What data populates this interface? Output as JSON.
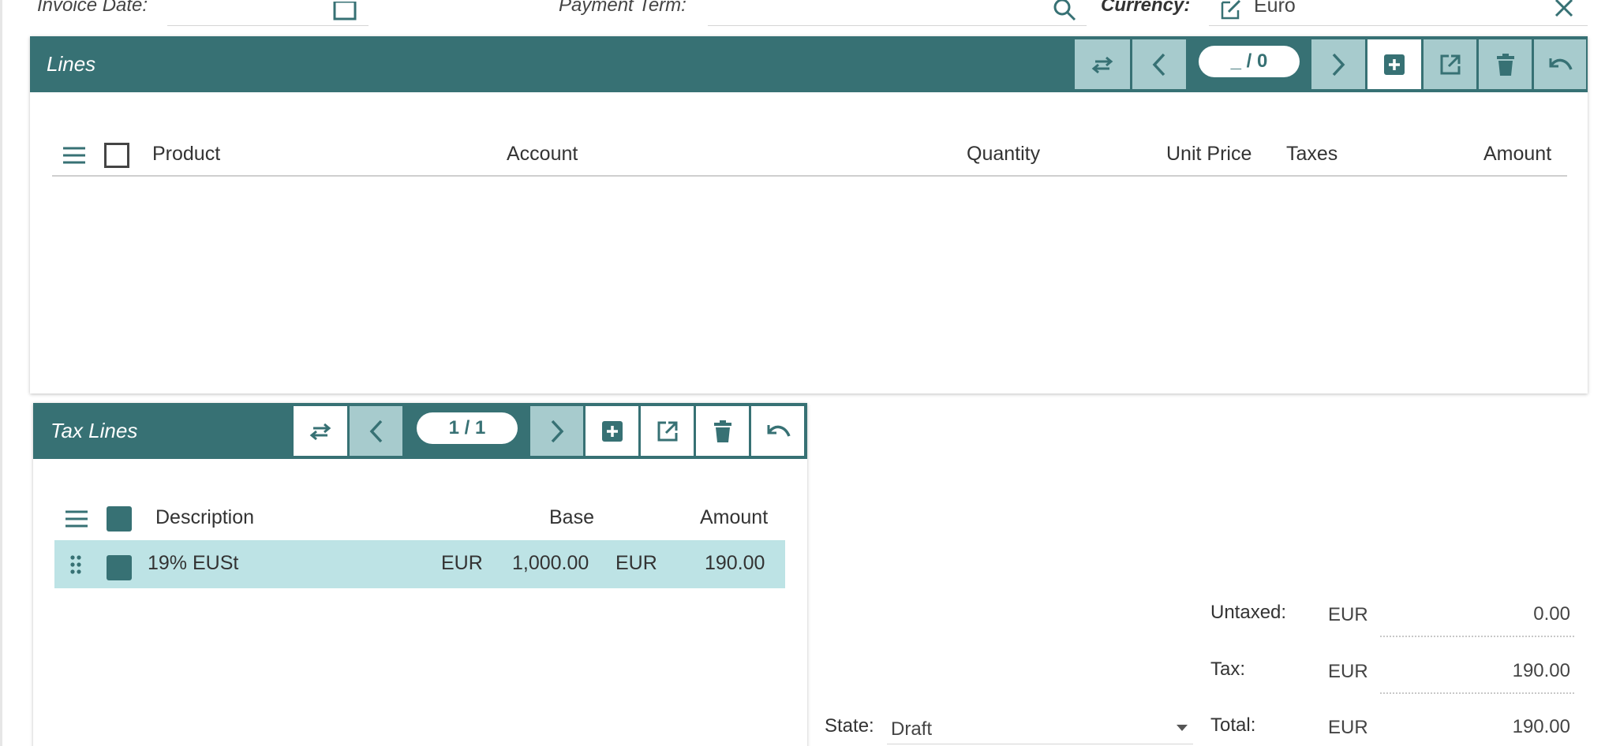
{
  "top_fields": {
    "invoice_date_label": "Invoice Date:",
    "payment_term_label": "Payment Term:",
    "currency_label": "Currency:",
    "currency_value": "Euro"
  },
  "lines": {
    "title": "Lines",
    "counter": "_ / 0",
    "columns": [
      "Product",
      "Account",
      "Quantity",
      "Unit Price",
      "Taxes",
      "Amount"
    ]
  },
  "tax_lines": {
    "title": "Tax Lines",
    "counter": "1 / 1",
    "columns": [
      "Description",
      "Base",
      "Amount"
    ],
    "rows": [
      {
        "description": "19% EUSt",
        "base_currency": "EUR",
        "base": "1,000.00",
        "amount_currency": "EUR",
        "amount": "190.00"
      }
    ]
  },
  "state": {
    "label": "State:",
    "value": "Draft"
  },
  "totals": {
    "untaxed_label": "Untaxed:",
    "untaxed_currency": "EUR",
    "untaxed_value": "0.00",
    "tax_label": "Tax:",
    "tax_currency": "EUR",
    "tax_value": "190.00",
    "total_label": "Total:",
    "total_currency": "EUR",
    "total_value": "190.00"
  },
  "colors": {
    "accent": "#377174",
    "light_accent": "#a7cbcd",
    "row_highlight": "#bde3e5"
  }
}
